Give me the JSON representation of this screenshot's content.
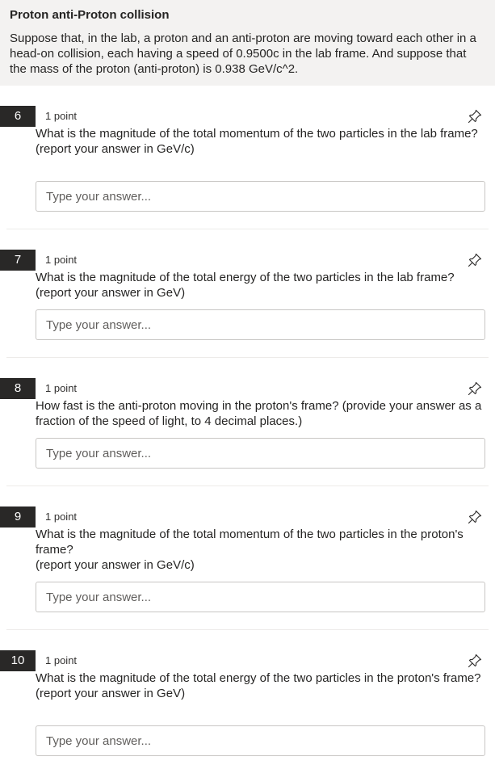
{
  "section": {
    "title": "Proton anti-Proton collision",
    "description": "Suppose that, in the lab, a proton and an anti-proton are moving toward each other in a head-on collision, each having a speed of 0.9500c in the lab frame. And suppose that the mass of the proton (anti-proton) is 0.938 GeV/c^2."
  },
  "questions": [
    {
      "number": "6",
      "points": "1 point",
      "text": "What is the magnitude of the total momentum of the two particles in the lab frame?\n(report your answer in GeV/c)",
      "placeholder": "Type your answer...",
      "pin_icon": "pin-icon"
    },
    {
      "number": "7",
      "points": "1 point",
      "text": "What is the magnitude of the total energy of the two particles in the lab frame?\n(report your answer in GeV)",
      "placeholder": "Type your answer...",
      "pin_icon": "pin-icon"
    },
    {
      "number": "8",
      "points": "1 point",
      "text": "How fast is the anti-proton moving in the proton's frame? (provide your answer as a fraction of the speed of light, to 4 decimal places.)",
      "placeholder": "Type your answer...",
      "pin_icon": "pin-icon"
    },
    {
      "number": "9",
      "points": "1 point",
      "text": "What is the magnitude of the total momentum of the two particles in the proton's frame?\n(report your answer in GeV/c)",
      "placeholder": "Type your answer...",
      "pin_icon": "pin-icon"
    },
    {
      "number": "10",
      "points": "1 point",
      "text": "What is the magnitude of the total energy of the two particles in the proton's frame?\n(report your answer in GeV)",
      "placeholder": "Type your answer...",
      "pin_icon": "pin-icon"
    }
  ],
  "colors": {
    "header_background": "#f3f2f1",
    "number_badge": "#292827",
    "input_border": "#c8c6c4"
  }
}
